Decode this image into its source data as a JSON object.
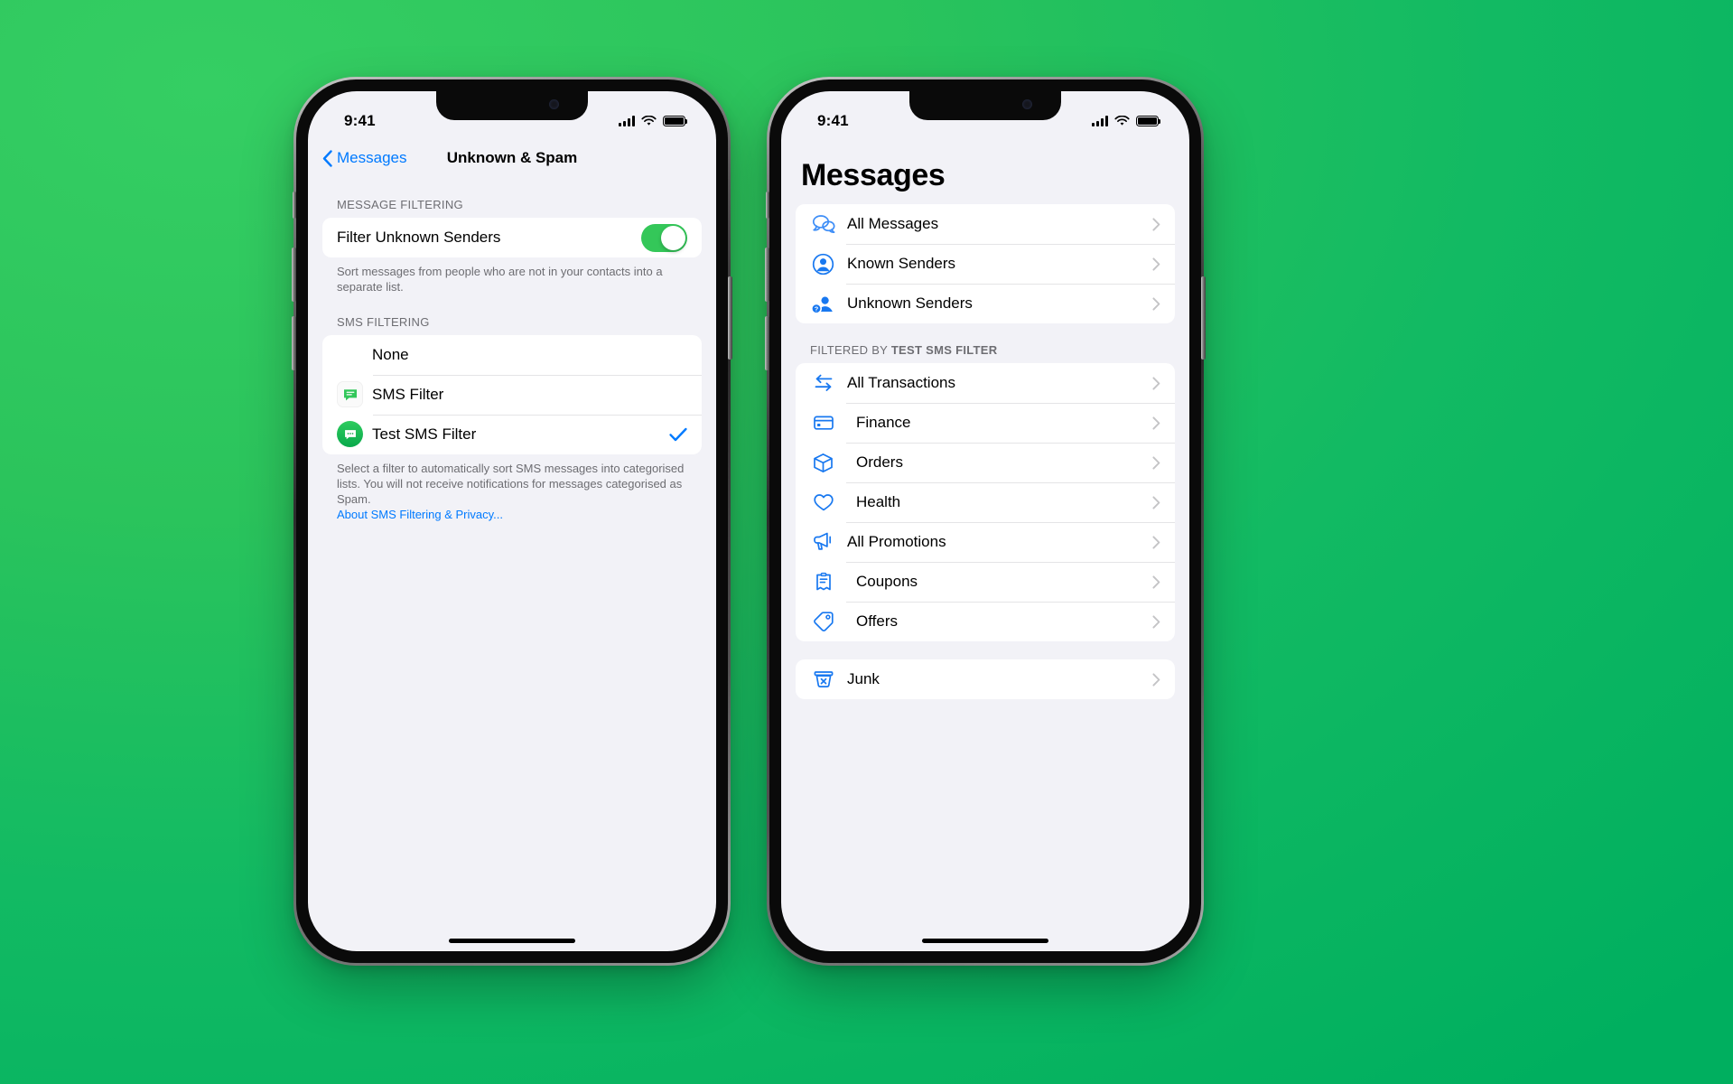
{
  "background": {
    "accent_green": "#2BC45C",
    "accent_teal": "#00AF5F"
  },
  "colors": {
    "tint_blue": "#007AFF",
    "toggle_green": "#34C759",
    "label_gray": "#6D6D72"
  },
  "phone_left": {
    "status_bar": {
      "time": "9:41"
    },
    "nav": {
      "back_label": "Messages",
      "title": "Unknown & Spam"
    },
    "sections": [
      {
        "header": "MESSAGE FILTERING",
        "rows": [
          {
            "label": "Filter Unknown Senders",
            "control": "toggle",
            "toggle_on": true
          }
        ],
        "footer": "Sort messages from people who are not in your contacts into a separate list."
      },
      {
        "header": "SMS FILTERING",
        "rows": [
          {
            "label": "None",
            "icon": "none",
            "selected": false
          },
          {
            "label": "SMS Filter",
            "icon": "sms-filter-app-icon",
            "selected": false
          },
          {
            "label": "Test SMS Filter",
            "icon": "test-sms-filter-app-icon",
            "selected": true
          }
        ],
        "footer": "Select a filter to automatically sort SMS messages into categorised lists. You will not receive notifications for messages categorised as Spam.",
        "footer_link": "About SMS Filtering & Privacy..."
      }
    ]
  },
  "phone_right": {
    "status_bar": {
      "time": "9:41"
    },
    "title": "Messages",
    "sections": [
      {
        "header": "",
        "rows": [
          {
            "label": "All Messages",
            "icon": "chat-bubbles-icon",
            "indent": false
          },
          {
            "label": "Known Senders",
            "icon": "person-circle-icon",
            "indent": false
          },
          {
            "label": "Unknown Senders",
            "icon": "person-question-icon",
            "indent": false
          }
        ]
      },
      {
        "header_prefix": "FILTERED BY ",
        "header_bold": "TEST SMS FILTER",
        "rows": [
          {
            "label": "All Transactions",
            "icon": "arrows-exchange-icon",
            "indent": false
          },
          {
            "label": "Finance",
            "icon": "credit-card-icon",
            "indent": true
          },
          {
            "label": "Orders",
            "icon": "box-icon",
            "indent": true
          },
          {
            "label": "Health",
            "icon": "heart-icon",
            "indent": true
          },
          {
            "label": "All Promotions",
            "icon": "megaphone-icon",
            "indent": false
          },
          {
            "label": "Coupons",
            "icon": "coupon-icon",
            "indent": true
          },
          {
            "label": "Offers",
            "icon": "tag-icon",
            "indent": true
          }
        ]
      },
      {
        "header": "",
        "rows": [
          {
            "label": "Junk",
            "icon": "trash-x-icon",
            "indent": false
          }
        ]
      }
    ]
  }
}
